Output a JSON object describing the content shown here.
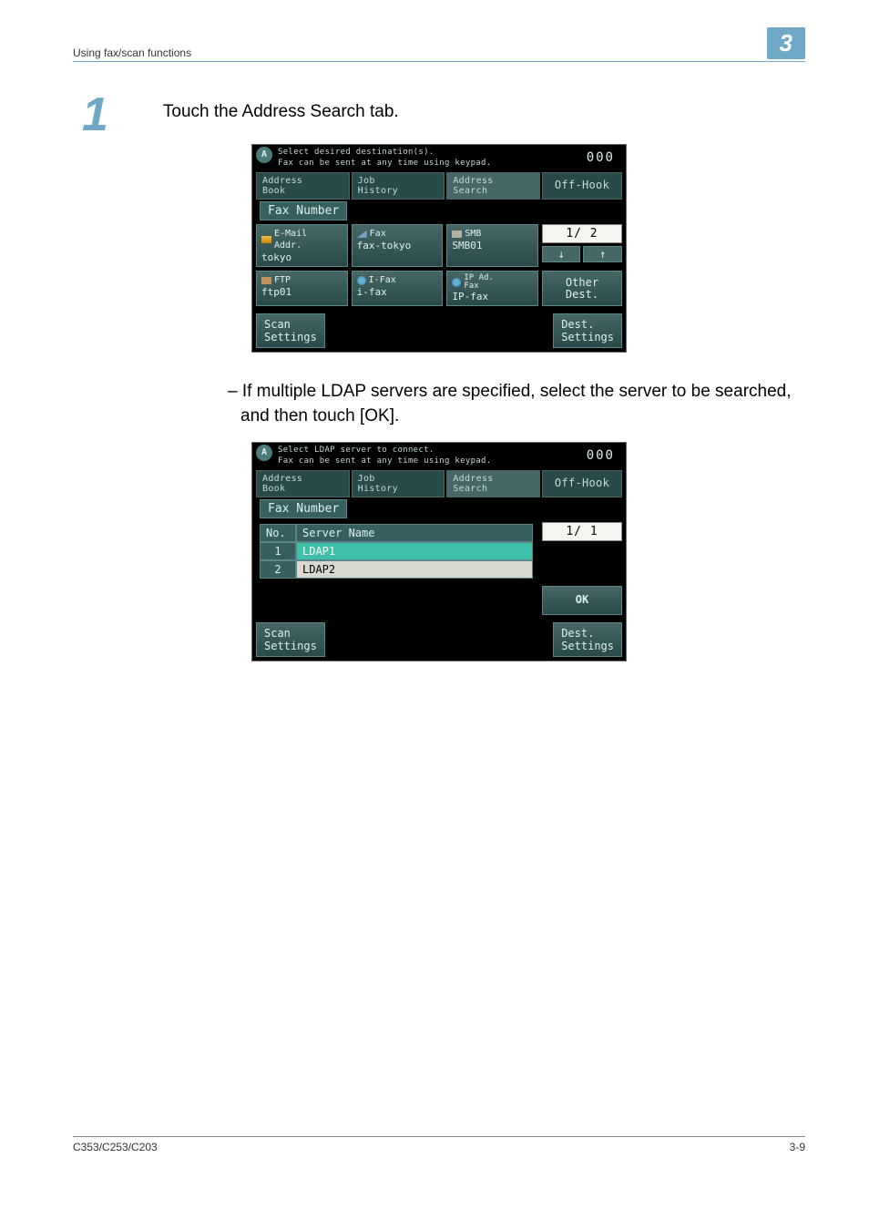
{
  "header": {
    "section_title": "Using fax/scan functions",
    "chapter_number": "3"
  },
  "step": {
    "number": "1",
    "text": "Touch the Address Search tab."
  },
  "note": "– If multiple LDAP servers are specified, select the server to be searched, and then touch [OK].",
  "screenshot1": {
    "title_line1": "Select desired destination(s).",
    "title_line2": "Fax can be sent at any time using keypad.",
    "counter": "000",
    "tabs": {
      "address_book": "Address\nBook",
      "job_history": "Job\nHistory",
      "address_search": "Address\nSearch",
      "off_hook": "Off-Hook"
    },
    "band": "Fax Number",
    "cards": {
      "email_top": "E-Mail\nAddr.",
      "email_val": "tokyo",
      "fax_top": "Fax",
      "fax_val": "fax-tokyo",
      "smb_top": "SMB",
      "smb_val": "SMB01",
      "ftp_top": "FTP",
      "ftp_val": "ftp01",
      "ifax_top": "I-Fax",
      "ifax_val": "i-fax",
      "ipfax_top": "IP Ad.\nFax",
      "ipfax_val": "IP-fax"
    },
    "page_indicator": "1/  2",
    "other_dest": "Other\nDest.",
    "scan_settings": "Scan\nSettings",
    "dest_settings": "Dest.\nSettings"
  },
  "screenshot2": {
    "title_line1": "Select LDAP server to connect.",
    "title_line2": "Fax can be sent at any time using keypad.",
    "counter": "000",
    "tabs": {
      "address_book": "Address\nBook",
      "job_history": "Job\nHistory",
      "address_search": "Address\nSearch",
      "off_hook": "Off-Hook"
    },
    "band": "Fax Number",
    "table": {
      "col_no": "No.",
      "col_name": "Server Name",
      "rows": [
        {
          "no": "1",
          "name": "LDAP1"
        },
        {
          "no": "2",
          "name": "LDAP2"
        }
      ]
    },
    "page_indicator": "1/  1",
    "ok": "OK",
    "scan_settings": "Scan\nSettings",
    "dest_settings": "Dest.\nSettings"
  },
  "footer": {
    "model": "C353/C253/C203",
    "page": "3-9"
  }
}
